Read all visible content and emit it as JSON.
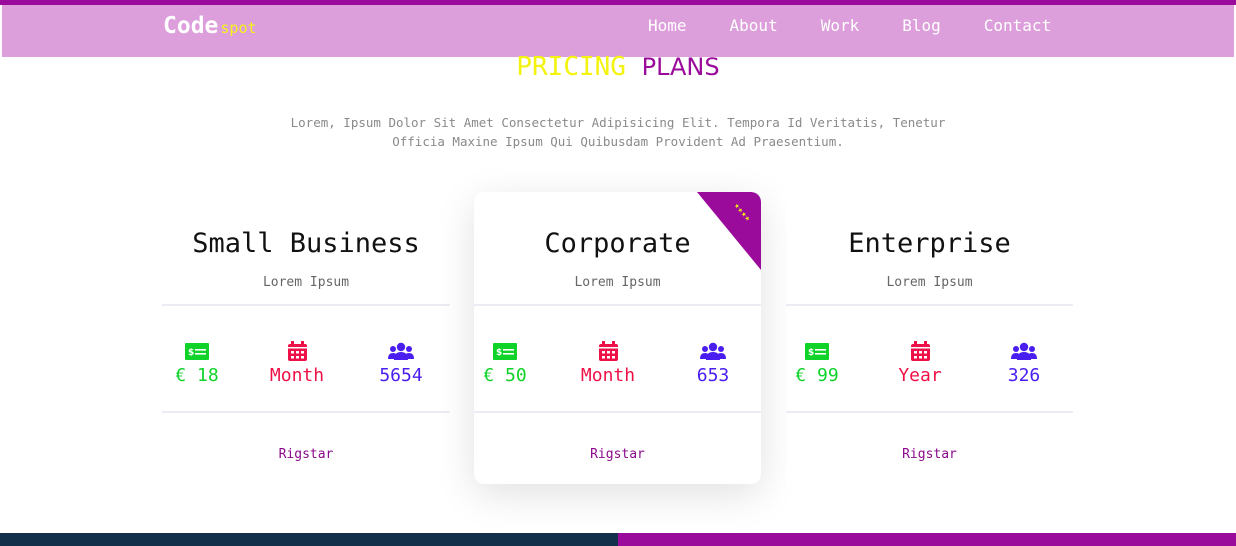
{
  "brand": {
    "main": "Code",
    "sub": "spot"
  },
  "nav": [
    "Home",
    "About",
    "Work",
    "Blog",
    "Contact"
  ],
  "section": {
    "title_1": "PRICING",
    "title_2": "PLANS",
    "description_line1": "Lorem, Ipsum Dolor Sit Amet Consectetur Adipisicing Elit. Tempora Id Veritatis, Tenetur",
    "description_line2": "Officia Maxine Ipsum Qui Quibusdam Provident Ad Praesentium."
  },
  "plans": [
    {
      "name": "Small Business",
      "subtitle": "Lorem Ipsum",
      "price": "€ 18",
      "period": "Month",
      "users": "5654",
      "cta": "Rigstar"
    },
    {
      "name": "Corporate",
      "subtitle": "Lorem Ipsum",
      "price": "€ 50",
      "period": "Month",
      "users": "653",
      "cta": "Rigstar",
      "ribbon": "★★★★"
    },
    {
      "name": "Enterprise",
      "subtitle": "Lorem Ipsum",
      "price": "€ 99",
      "period": "Year",
      "users": "326",
      "cta": "Rigstar"
    }
  ],
  "icons": {
    "price": "money-bill-icon",
    "period": "calendar-icon",
    "users": "users-icon"
  },
  "colors": {
    "navbar": "#dd9fdb",
    "accent_purple": "#9b0b9b",
    "accent_yellow": "#f3f30f",
    "price": "#10d32a",
    "period": "#ee1148",
    "users": "#4b1ef0",
    "footer_left": "#13304a",
    "footer_right": "#9b0b9b"
  }
}
